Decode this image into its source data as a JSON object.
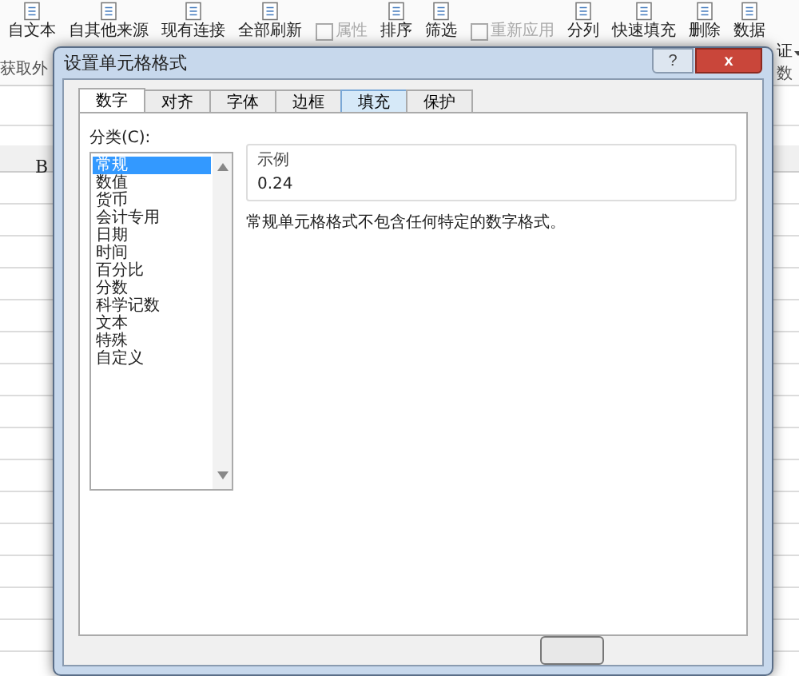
{
  "ribbon": {
    "items": [
      {
        "label": "自文本",
        "kind": "large",
        "disabled": false
      },
      {
        "label": "自其他来源",
        "kind": "large",
        "disabled": false
      },
      {
        "label": "现有连接",
        "kind": "large",
        "disabled": false
      },
      {
        "label": "全部刷新",
        "kind": "large",
        "disabled": false
      },
      {
        "label": "属性",
        "kind": "small",
        "disabled": true
      },
      {
        "label": "排序",
        "kind": "large",
        "disabled": false
      },
      {
        "label": "筛选",
        "kind": "large",
        "disabled": false
      },
      {
        "label": "重新应用",
        "kind": "small",
        "disabled": true
      },
      {
        "label": "分列",
        "kind": "large",
        "disabled": false
      },
      {
        "label": "快速填充",
        "kind": "large",
        "disabled": false
      },
      {
        "label": "删除",
        "kind": "large",
        "disabled": false
      },
      {
        "label": "数据",
        "kind": "large",
        "disabled": false
      }
    ],
    "group_labels": [
      "获取外",
      "数"
    ],
    "dropdown_suffix": "证"
  },
  "sheet": {
    "column_header": "B"
  },
  "dialog": {
    "title": "设置单元格格式",
    "help": "?",
    "close": "x",
    "tabs": [
      {
        "label": "数字",
        "selected": true,
        "highlighted": false
      },
      {
        "label": "对齐",
        "selected": false,
        "highlighted": false
      },
      {
        "label": "字体",
        "selected": false,
        "highlighted": false
      },
      {
        "label": "边框",
        "selected": false,
        "highlighted": false
      },
      {
        "label": "填充",
        "selected": false,
        "highlighted": true
      },
      {
        "label": "保护",
        "selected": false,
        "highlighted": false
      }
    ],
    "category_label": "分类(C):",
    "categories": [
      {
        "label": "常规",
        "selected": true
      },
      {
        "label": "数值",
        "selected": false
      },
      {
        "label": "货币",
        "selected": false
      },
      {
        "label": "会计专用",
        "selected": false
      },
      {
        "label": "日期",
        "selected": false
      },
      {
        "label": "时间",
        "selected": false
      },
      {
        "label": "百分比",
        "selected": false
      },
      {
        "label": "分数",
        "selected": false
      },
      {
        "label": "科学记数",
        "selected": false
      },
      {
        "label": "文本",
        "selected": false
      },
      {
        "label": "特殊",
        "selected": false
      },
      {
        "label": "自定义",
        "selected": false
      }
    ],
    "sample": {
      "legend": "示例",
      "value": "0.24"
    },
    "description": "常规单元格格式不包含任何特定的数字格式。"
  }
}
